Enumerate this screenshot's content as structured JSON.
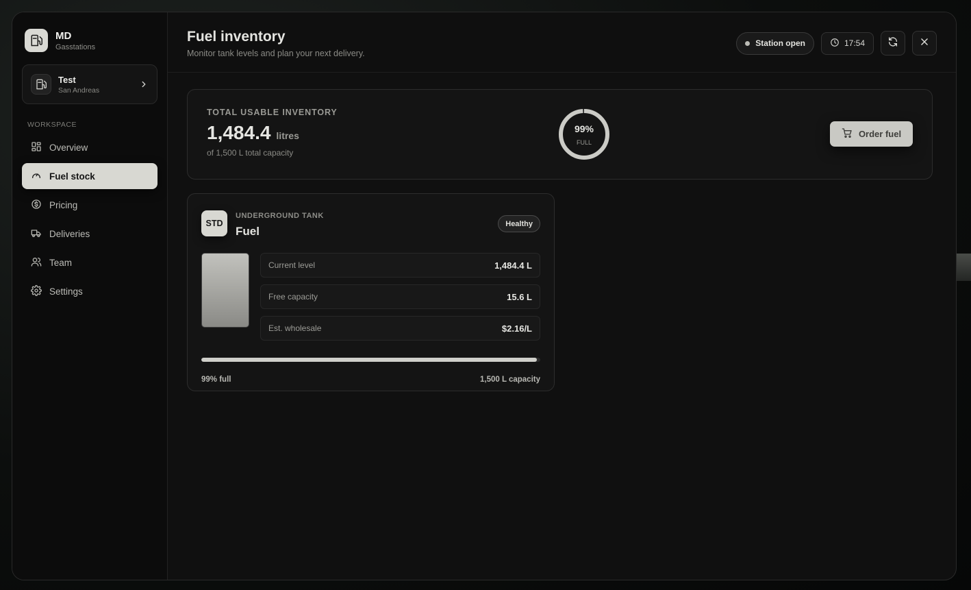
{
  "brand": {
    "title": "MD",
    "subtitle": "Gasstations",
    "icon": "fuel-pump-icon"
  },
  "station": {
    "name": "Test",
    "location": "San Andreas"
  },
  "sidebar": {
    "section_label": "WORKSPACE",
    "items": [
      {
        "label": "Overview",
        "icon": "grid-icon",
        "active": false
      },
      {
        "label": "Fuel stock",
        "icon": "gauge-icon",
        "active": true
      },
      {
        "label": "Pricing",
        "icon": "dollar-icon",
        "active": false
      },
      {
        "label": "Deliveries",
        "icon": "truck-icon",
        "active": false
      },
      {
        "label": "Team",
        "icon": "users-icon",
        "active": false
      },
      {
        "label": "Settings",
        "icon": "gear-icon",
        "active": false
      }
    ]
  },
  "header": {
    "title": "Fuel inventory",
    "subtitle": "Monitor tank levels and plan your next delivery.",
    "status": "Station open",
    "time": "17:54"
  },
  "summary": {
    "label": "TOTAL USABLE INVENTORY",
    "value": "1,484.4",
    "unit": "litres",
    "capacity_text": "of 1,500 L total capacity",
    "gauge_percent": "99%",
    "gauge_label": "FULL",
    "gauge_fraction": 0.99,
    "order_button": "Order fuel"
  },
  "tank": {
    "badge": "STD",
    "kind": "UNDERGROUND TANK",
    "name": "Fuel",
    "status": "Healthy",
    "metrics": [
      {
        "label": "Current level",
        "value": "1,484.4 L"
      },
      {
        "label": "Free capacity",
        "value": "15.6 L"
      },
      {
        "label": "Est. wholesale",
        "value": "$2.16/L"
      }
    ],
    "fill_fraction": 0.99,
    "percent_text": "99% full",
    "capacity_text": "1,500 L capacity"
  },
  "colors": {
    "accent": "#d8d8d2",
    "background": "#101010",
    "panel": "#141414"
  }
}
